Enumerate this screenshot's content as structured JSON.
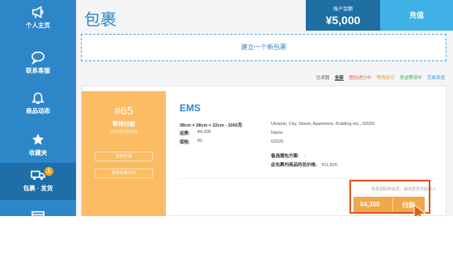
{
  "sidebar": {
    "items": [
      {
        "label": "个人主页",
        "icon": "megaphone-icon"
      },
      {
        "label": "联系客服",
        "icon": "chat-bubble-icon"
      },
      {
        "label": "商品动态",
        "icon": "bell-icon"
      },
      {
        "label": "收藏夹",
        "icon": "star-icon"
      },
      {
        "label": "包裹 · 发货",
        "icon": "truck-icon",
        "badge": "1"
      },
      {
        "label": "",
        "icon": "card-icon"
      }
    ]
  },
  "header": {
    "title": "包裹",
    "balance_label": "账户金额",
    "balance_value": "¥5,000",
    "recharge_label": "充值"
  },
  "new_package_label": "建立一个新包裹",
  "filters": {
    "label": "过滤器",
    "all": "全部",
    "items": [
      "捆包进行中",
      "等待支付",
      "发送等待中",
      "完成发送"
    ]
  },
  "package": {
    "number": "#65",
    "status": "等待付款",
    "date": "2021年5月26日",
    "panel_buttons": [
      "定制包装",
      "查看包裹内容"
    ],
    "carrier": "EMS",
    "dimensions": "38cm × 28cm × 22cm - 1065克",
    "shipping_label": "运费:",
    "shipping_value": "¥4,300",
    "insurance_label": "保险:",
    "insurance_value": "¥0",
    "address": "Ukraine, City, Street, Apartment, Building etc., 02020",
    "name": "Name",
    "zip": "02020",
    "alt_plan_label": "备选捆包方案:",
    "alt_plan_value": "-",
    "total_label": "此包裹内商品的总价格:",
    "total_value": "¥11,820",
    "hint": "有折扣码的会员，请点击支付后输入",
    "pay_amount": "¥4,300",
    "pay_label": "付款"
  },
  "colors": {
    "sidebar": "#2d86c8",
    "accent_orange": "#f0a84a",
    "status_panel": "#fbbc63",
    "highlight": "#d9541c"
  }
}
